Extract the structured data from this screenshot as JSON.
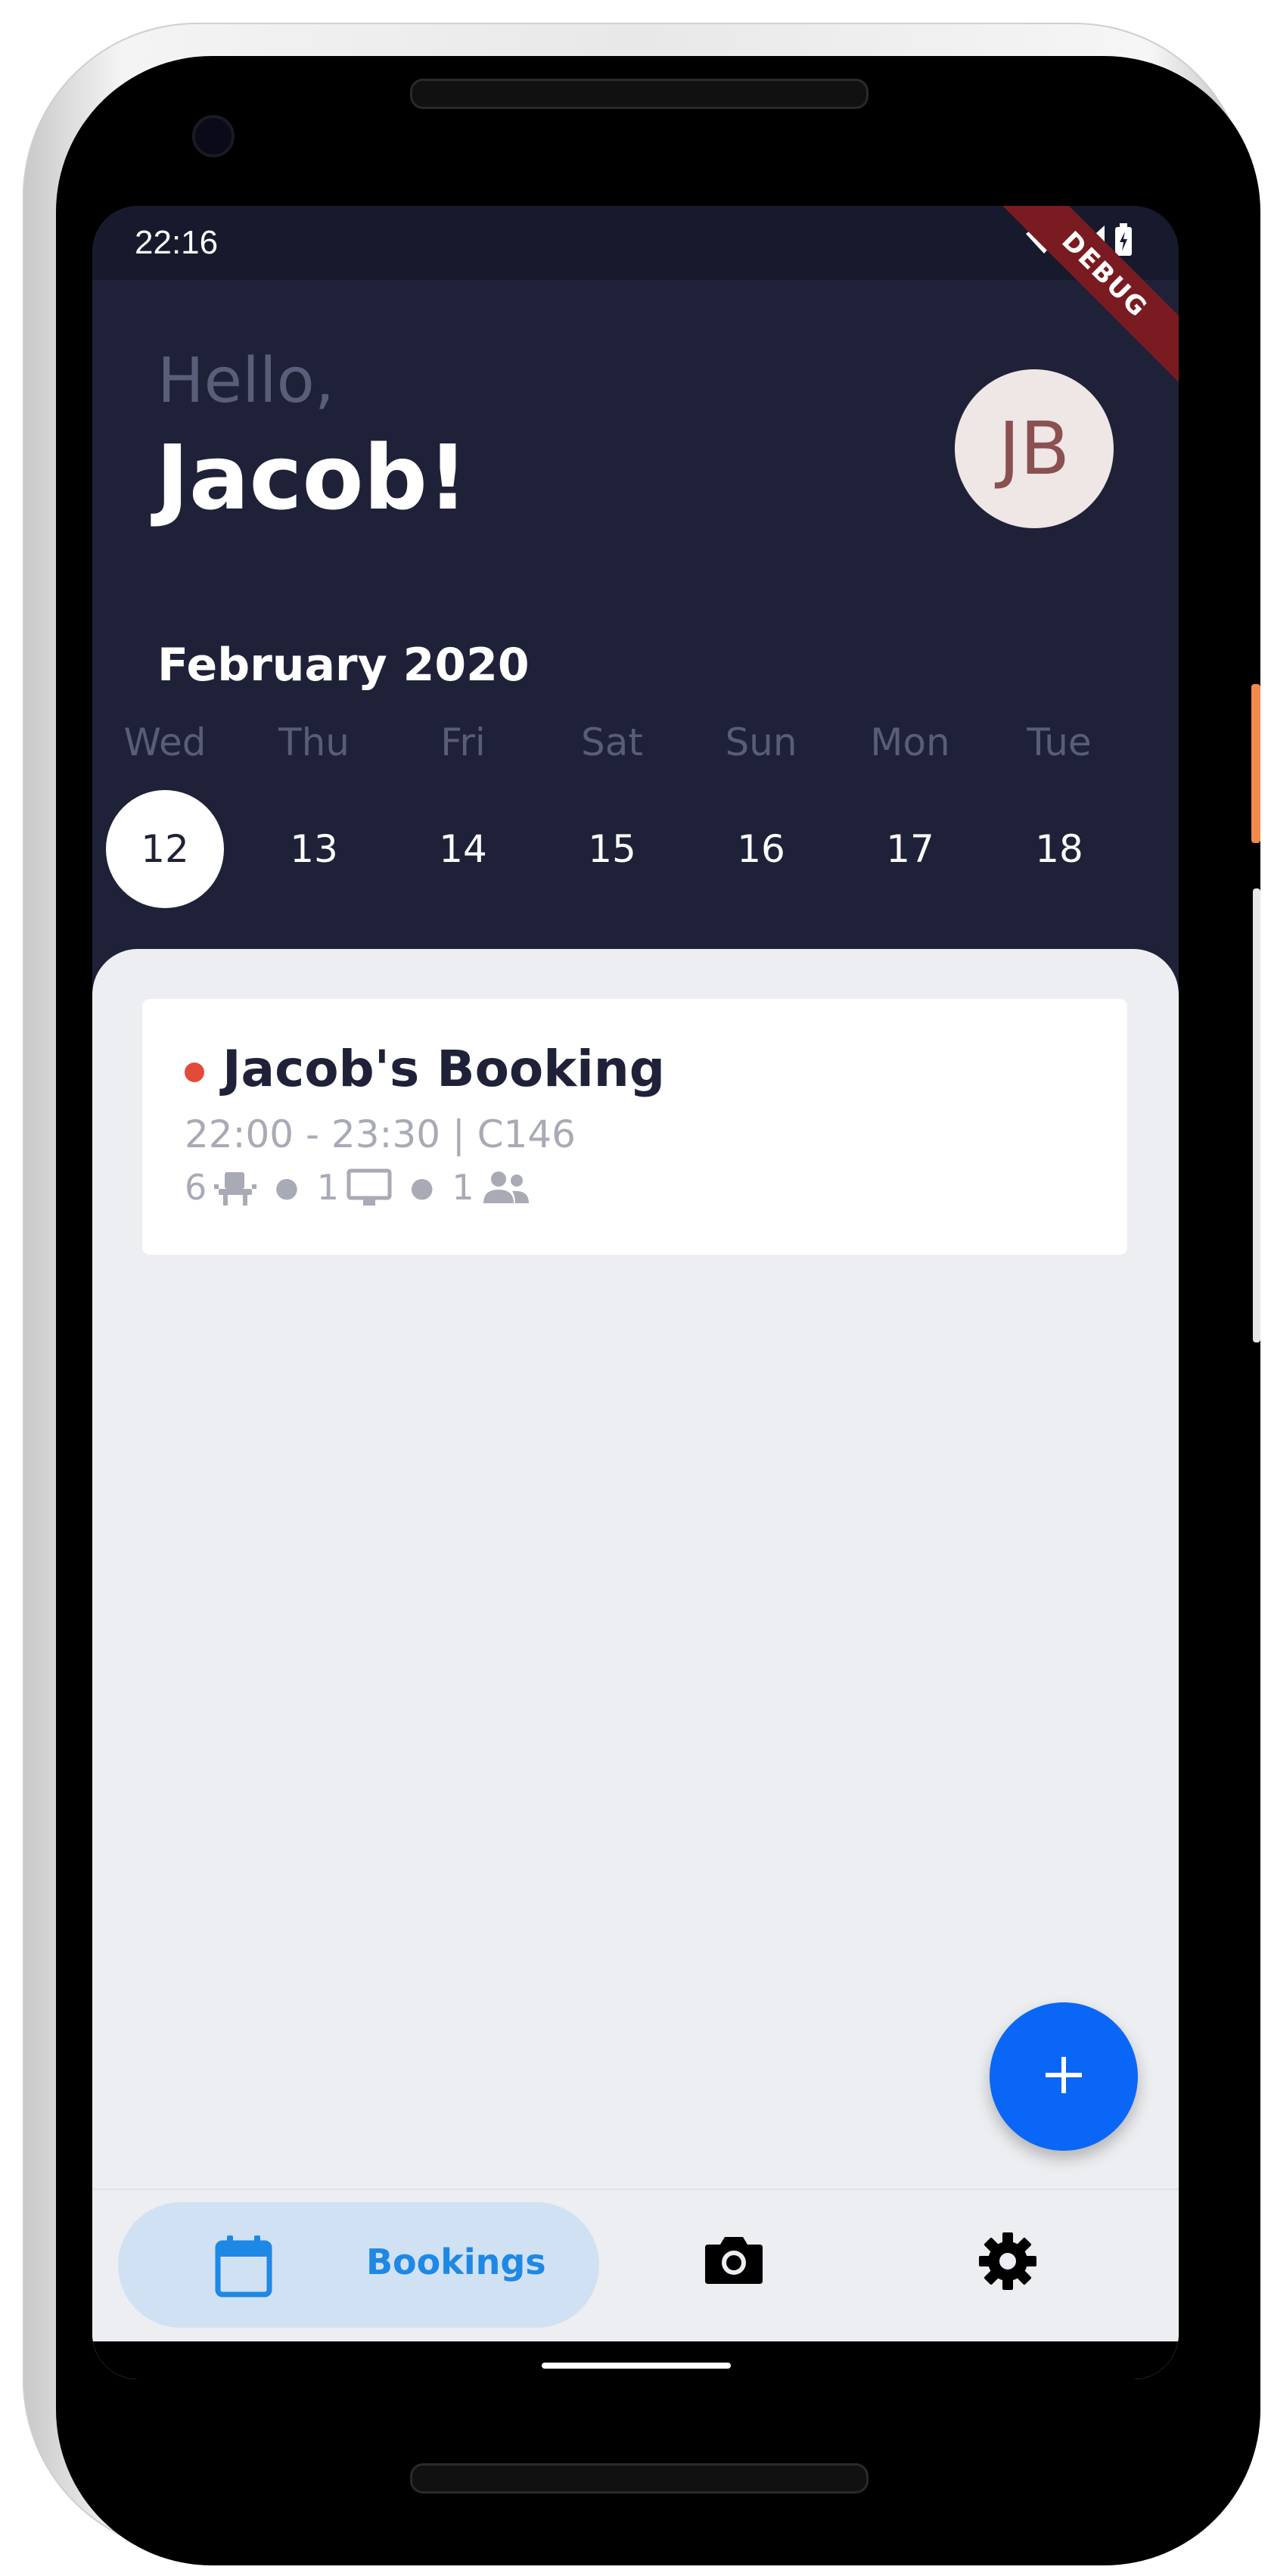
{
  "status_bar": {
    "time": "22:16",
    "debug_label": "DEBUG"
  },
  "header": {
    "greeting": "Hello,",
    "user_name": "Jacob!",
    "avatar_initials": "JB"
  },
  "calendar": {
    "month_label": "February 2020",
    "days": [
      {
        "name": "Wed",
        "number": "12",
        "selected": true
      },
      {
        "name": "Thu",
        "number": "13",
        "selected": false
      },
      {
        "name": "Fri",
        "number": "14",
        "selected": false
      },
      {
        "name": "Sat",
        "number": "15",
        "selected": false
      },
      {
        "name": "Sun",
        "number": "16",
        "selected": false
      },
      {
        "name": "Mon",
        "number": "17",
        "selected": false
      },
      {
        "name": "Tue",
        "number": "18",
        "selected": false
      }
    ]
  },
  "bookings": [
    {
      "title": "Jacob's Booking",
      "time_room": "22:00 - 23:30 | C146",
      "seats": "6",
      "screens": "1",
      "people": "1",
      "status_color": "#e24a3a"
    }
  ],
  "fab": {
    "icon": "plus-icon"
  },
  "bottom_nav": {
    "items": [
      {
        "label": "Bookings",
        "icon": "calendar-icon",
        "active": true
      },
      {
        "label": "",
        "icon": "camera-icon",
        "active": false
      },
      {
        "label": "",
        "icon": "gear-icon",
        "active": false
      }
    ]
  },
  "colors": {
    "header_bg": "#1f2138",
    "accent": "#0a66f6",
    "nav_active_bg": "#d0e1f3",
    "nav_active_text": "#1e88e5"
  }
}
